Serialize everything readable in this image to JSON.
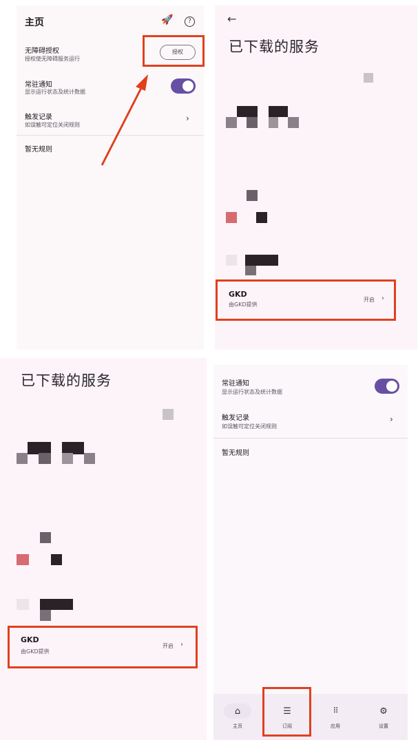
{
  "top_left": {
    "title": "主页",
    "rocket_icon": "rocket-icon",
    "help_icon": "help-icon",
    "accessibility": {
      "label": "无障碍授权",
      "sub": "授权使无障碍服务运行",
      "button": "授权"
    },
    "notification": {
      "label": "常驻通知",
      "sub": "显示运行状态及统计数据",
      "toggle_on": true
    },
    "records": {
      "label": "触发记录",
      "sub": "如误触可定位关闭规则"
    },
    "no_rules": "暂无规则"
  },
  "top_right": {
    "back_icon": "back-arrow-icon",
    "title": "已下载的服务",
    "card": {
      "name": "GKD",
      "sub": "由GKD提供",
      "status": "开启"
    }
  },
  "bottom_left": {
    "title": "已下载的服务",
    "card": {
      "name": "GKD",
      "sub": "由GKD提供",
      "status": "开启"
    }
  },
  "bottom_right": {
    "notification": {
      "label": "常驻通知",
      "sub": "显示运行状态及统计数据",
      "toggle_on": true
    },
    "records": {
      "label": "触发记录",
      "sub": "如误触可定位关闭规则"
    },
    "no_rules": "暂无规则",
    "nav": [
      {
        "label": "主页",
        "icon": "home-icon"
      },
      {
        "label": "订阅",
        "icon": "list-icon",
        "active": true
      },
      {
        "label": "应用",
        "icon": "apps-grid-icon"
      },
      {
        "label": "设置",
        "icon": "settings-icon"
      }
    ]
  },
  "colors": {
    "accent": "#6750a4",
    "annotation": "#e0401d"
  }
}
